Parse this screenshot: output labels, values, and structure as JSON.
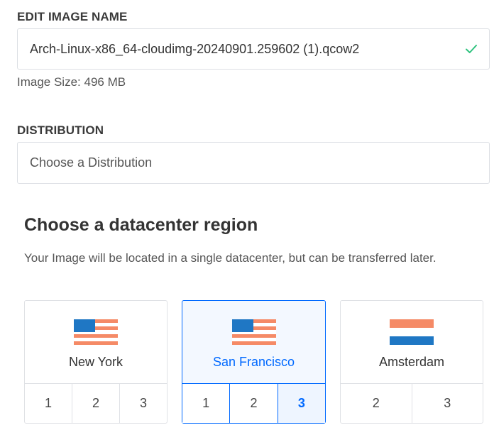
{
  "image_name": {
    "label": "EDIT IMAGE NAME",
    "value": "Arch-Linux-x86_64-cloudimg-20240901.259602 (1).qcow2",
    "size_text": "Image Size: 496 MB"
  },
  "distribution": {
    "label": "DISTRIBUTION",
    "placeholder": "Choose a Distribution"
  },
  "region": {
    "heading": "Choose a datacenter region",
    "description": "Your Image will be located in a single datacenter, but can be transferred later.",
    "cards": [
      {
        "city": "New York",
        "flag": "us-flag-icon",
        "numbers": [
          "1",
          "2",
          "3"
        ],
        "selected": false
      },
      {
        "city": "San Francisco",
        "flag": "us-flag-icon",
        "numbers": [
          "1",
          "2",
          "3"
        ],
        "selected": true,
        "active_number": "3"
      },
      {
        "city": "Amsterdam",
        "flag": "nl-flag-icon",
        "numbers": [
          "2",
          "3"
        ],
        "selected": false
      }
    ]
  },
  "colors": {
    "accent": "#0069ff",
    "valid_check": "#2ec27e",
    "us_flag_blue": "#1f77c4",
    "us_flag_stripe": "#f58a66",
    "nl_flag_red": "#f58a66",
    "nl_flag_blue": "#1f77c4"
  }
}
